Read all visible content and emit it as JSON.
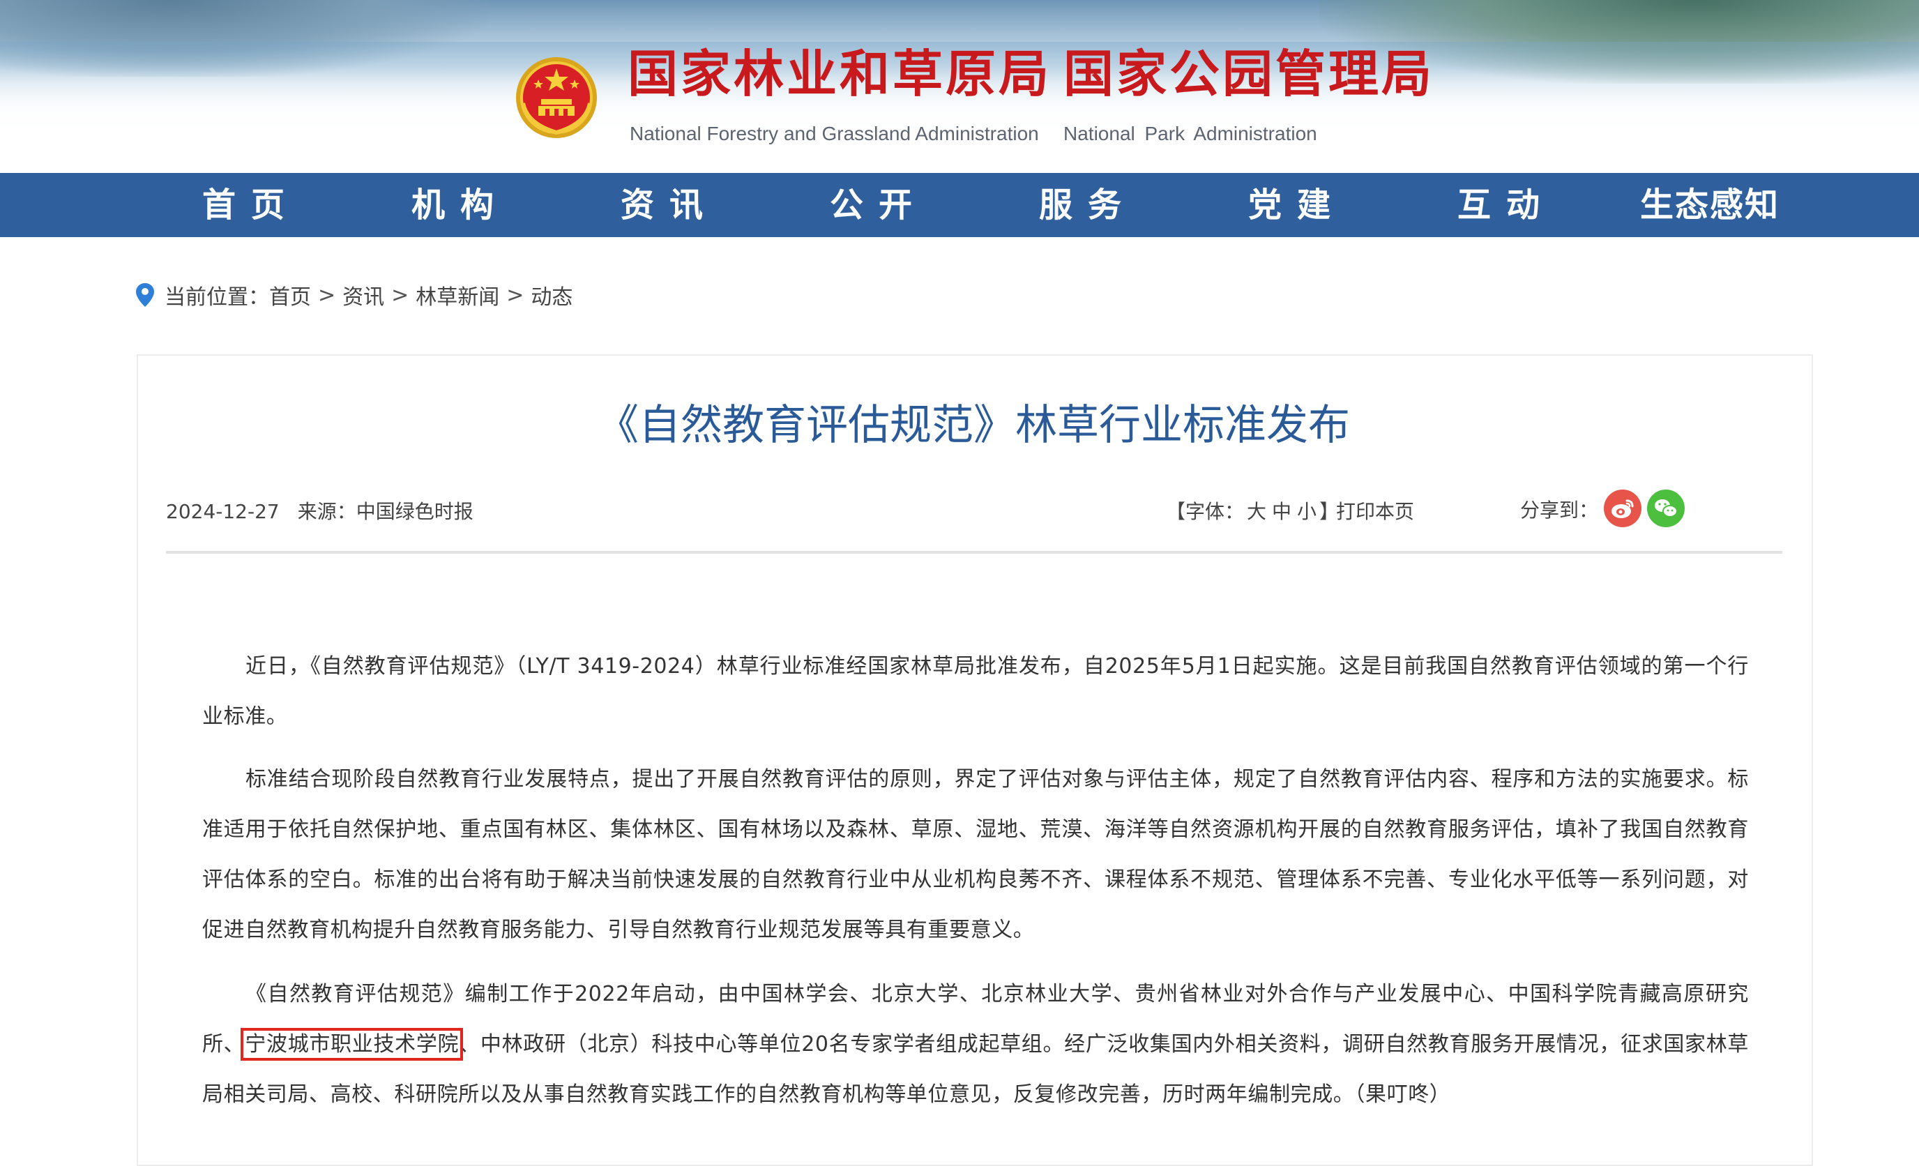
{
  "header": {
    "org_name_cn_1": "国家林业和草原局",
    "org_name_cn_2": "国家公园管理局",
    "org_name_en_1": "National Forestry and Grassland Administration",
    "org_name_en_2": "National Park Administration",
    "emblem_icon": "national-emblem-icon"
  },
  "nav": {
    "items": [
      "首页",
      "机构",
      "资讯",
      "公开",
      "服务",
      "党建",
      "互动",
      "生态感知"
    ],
    "background": "#2f5f9c"
  },
  "breadcrumb": {
    "icon": "location-pin-icon",
    "label": "当前位置：",
    "items": [
      "首页",
      "资讯",
      "林草新闻",
      "动态"
    ],
    "separator": ">"
  },
  "article": {
    "title": "《自然教育评估规范》林草行业标准发布",
    "date": "2024-12-27",
    "source": "来源：中国绿色时报",
    "font_label_prefix": "【字体：",
    "font_sizes": [
      "大",
      "中",
      "小"
    ],
    "font_label_suffix": "】",
    "print_label": "打印本页",
    "share_label": "分享到：",
    "share_icons": [
      "weibo-icon",
      "wechat-icon"
    ],
    "paragraphs": [
      "近日，《自然教育评估规范》（LY/T 3419-2024）林草行业标准经国家林草局批准发布，自2025年5月1日起实施。这是目前我国自然教育评估领域的第一个行业标准。",
      "标准结合现阶段自然教育行业发展特点，提出了开展自然教育评估的原则，界定了评估对象与评估主体，规定了自然教育评估内容、程序和方法的实施要求。标准适用于依托自然保护地、重点国有林区、集体林区、国有林场以及森林、草原、湿地、荒漠、海洋等自然资源机构开展的自然教育服务评估，填补了我国自然教育评估体系的空白。标准的出台将有助于解决当前快速发展的自然教育行业中从业机构良莠不齐、课程体系不规范、管理体系不完善、专业化水平低等一系列问题，对促进自然教育机构提升自然教育服务能力、引导自然教育行业规范发展等具有重要意义。"
    ],
    "p3_before": "《自然教育评估规范》编制工作于2022年启动，由中国林学会、北京大学、北京林业大学、贵州省林业对外合作与产业发展中心、中国科学院青藏高原研究所、",
    "p3_highlight": "宁波城市职业技术学院",
    "p3_after": "、中林政研（北京）科技中心等单位20名专家学者组成起草组。经广泛收集国内外相关资料，调研自然教育服务开展情况，征求国家林草局相关司局、高校、科研院所以及从事自然教育实践工作的自然教育机构等单位意见，反复修改完善，历时两年编制完成。（果叮咚）",
    "highlight_color": "#e0261f",
    "title_color": "#2a5a98"
  }
}
